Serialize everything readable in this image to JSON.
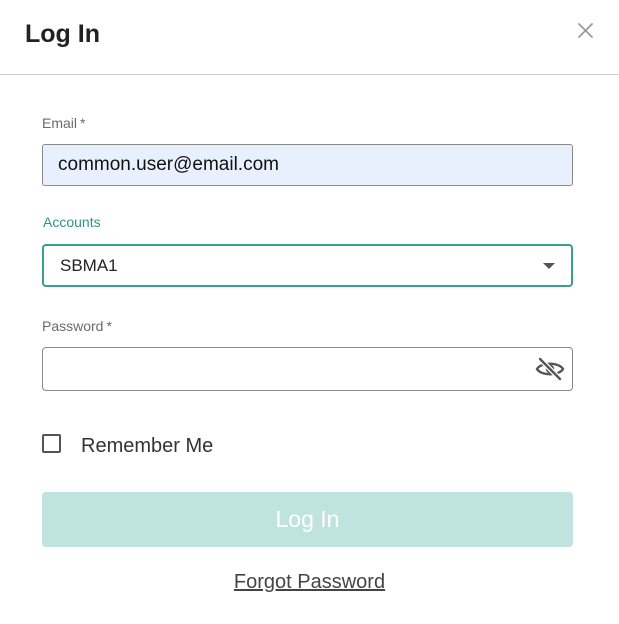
{
  "dialog": {
    "title": "Log In",
    "close_icon": "close-icon"
  },
  "email": {
    "label": "Email",
    "required_marker": "*",
    "value": "common.user@email.com"
  },
  "accounts": {
    "label": "Accounts",
    "selected": "SBMA1",
    "dropdown_icon": "chevron-down-icon",
    "accent_color": "#2f9680"
  },
  "password": {
    "label": "Password",
    "required_marker": "*",
    "value": "",
    "toggle_icon": "eye-slash-icon"
  },
  "remember_me": {
    "label": "Remember Me",
    "checked": false
  },
  "login_button": {
    "label": "Log In",
    "color": "#bfe3df"
  },
  "forgot_password": {
    "label": "Forgot Password"
  }
}
